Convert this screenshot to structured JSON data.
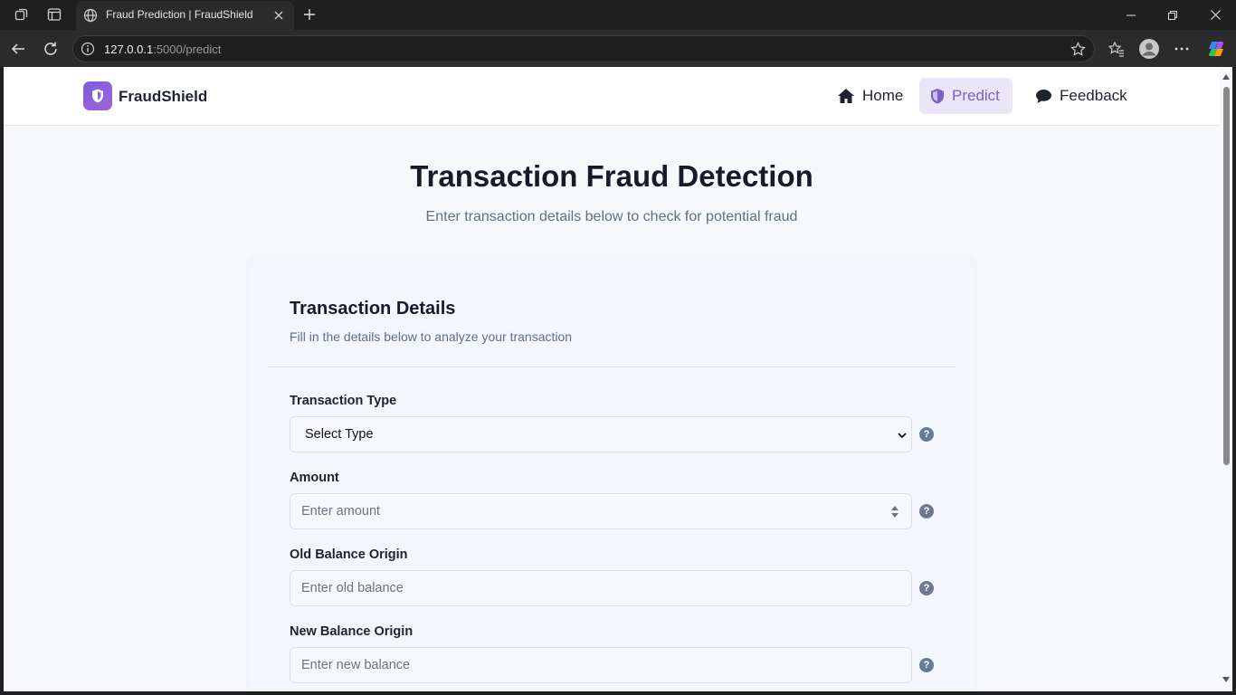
{
  "browser": {
    "tab_title": "Fraud Prediction | FraudShield",
    "url_host": "127.0.0.1",
    "url_path": ":5000/predict"
  },
  "navbar": {
    "brand": "FraudShield",
    "items": [
      {
        "label": "Home",
        "icon": "home-icon",
        "active": false
      },
      {
        "label": "Predict",
        "icon": "shield-icon",
        "active": true
      },
      {
        "label": "Feedback",
        "icon": "chat-bubble-icon",
        "active": false
      }
    ]
  },
  "hero": {
    "title": "Transaction Fraud Detection",
    "subtitle": "Enter transaction details below to check for potential fraud"
  },
  "form": {
    "title": "Transaction Details",
    "description": "Fill in the details below to analyze your transaction",
    "fields": [
      {
        "label": "Transaction Type",
        "kind": "select",
        "value": "Select Type"
      },
      {
        "label": "Amount",
        "kind": "number",
        "placeholder": "Enter amount"
      },
      {
        "label": "Old Balance Origin",
        "kind": "text",
        "placeholder": "Enter old balance"
      },
      {
        "label": "New Balance Origin",
        "kind": "text",
        "placeholder": "Enter new balance"
      }
    ]
  },
  "colors": {
    "accent": "#7a61c6",
    "active_nav_bg": "#ebe5f8",
    "page_bg": "#f6f8fc"
  }
}
